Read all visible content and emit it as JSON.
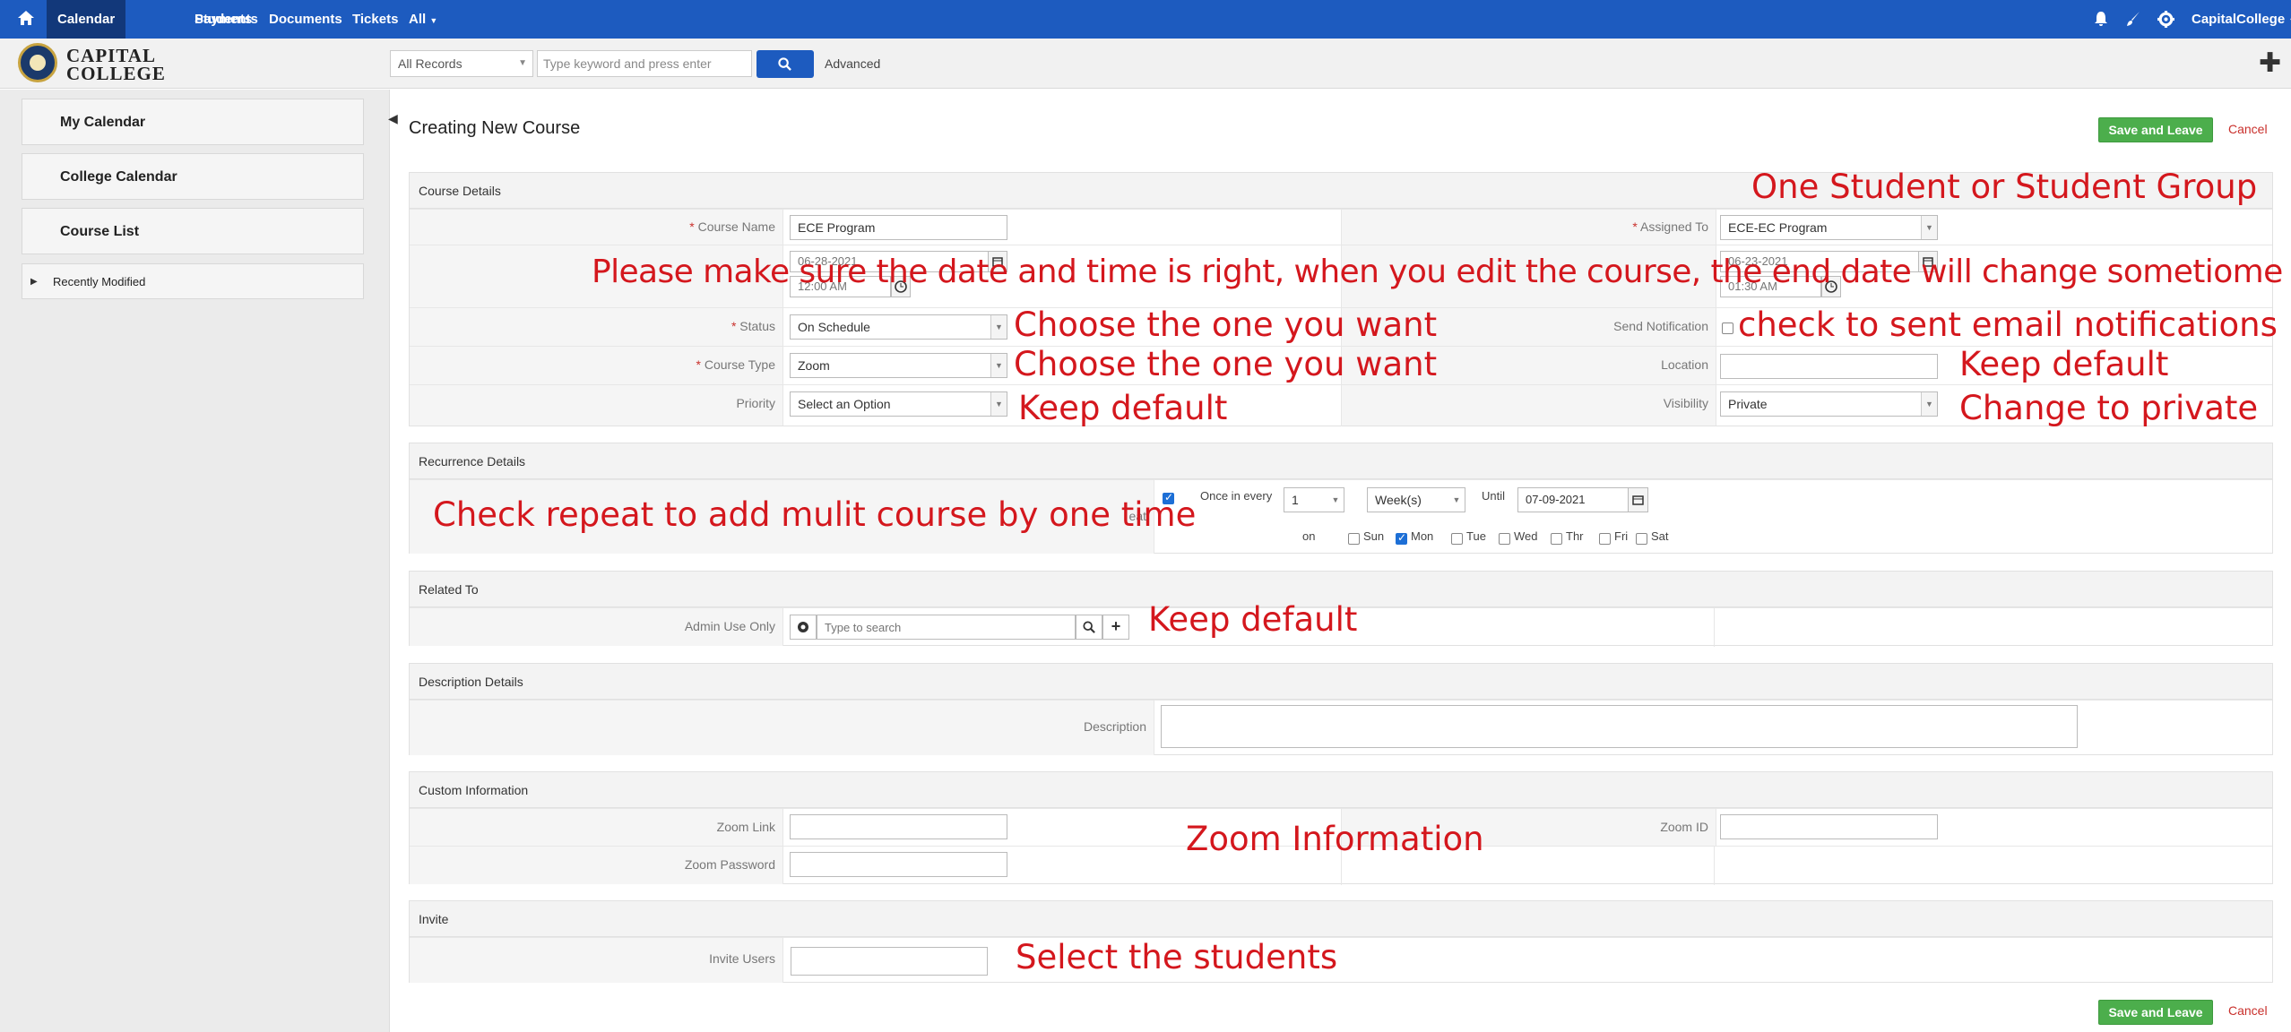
{
  "topnav": {
    "tabs": [
      "Calendar",
      "Students",
      "Payments",
      "Documents",
      "Tickets",
      "All"
    ],
    "user": "CapitalCollege"
  },
  "subbar": {
    "logo_line1": "CAPITAL",
    "logo_line2": "COLLEGE",
    "records_select": "All Records",
    "search_placeholder": "Type keyword and press enter",
    "advanced_label": "Advanced"
  },
  "sidebar": {
    "items": [
      "My Calendar",
      "College Calendar",
      "Course List"
    ],
    "recently_modified": "Recently Modified"
  },
  "page": {
    "title": "Creating New Course",
    "save_label": "Save and Leave",
    "cancel_label": "Cancel"
  },
  "course_details": {
    "heading": "Course Details",
    "course_name_label": "Course Name",
    "course_name_value": "ECE Program",
    "assigned_to_label": "Assigned To",
    "assigned_to_value": "ECE-EC Program",
    "start_date": "06-28-2021",
    "start_time": "12:00 AM",
    "end_date": "06-23-2021",
    "end_time": "01:30 AM",
    "status_label": "Status",
    "status_value": "On Schedule",
    "send_notification_label": "Send Notification",
    "course_type_label": "Course Type",
    "course_type_value": "Zoom",
    "location_label": "Location",
    "priority_label": "Priority",
    "priority_value": "Select an Option",
    "visibility_label": "Visibility",
    "visibility_value": "Private"
  },
  "recurrence": {
    "heading": "Recurrence Details",
    "repeat_label_fragment": "eat",
    "once_in_every_label": "Once in every",
    "interval_value": "1",
    "unit_value": "Week(s)",
    "until_label": "Until",
    "until_value": "07-09-2021",
    "on_label": "on",
    "days": [
      "Sun",
      "Mon",
      "Tue",
      "Wed",
      "Thr",
      "Fri",
      "Sat"
    ],
    "days_checked": [
      false,
      true,
      false,
      false,
      false,
      false,
      false
    ]
  },
  "related": {
    "heading": "Related To",
    "admin_label": "Admin Use Only",
    "search_placeholder": "Type to search"
  },
  "description": {
    "heading": "Description Details",
    "label": "Description"
  },
  "custom": {
    "heading": "Custom Information",
    "zoom_link_label": "Zoom Link",
    "zoom_id_label": "Zoom ID",
    "zoom_password_label": "Zoom Password"
  },
  "invite": {
    "heading": "Invite",
    "label": "Invite Users"
  },
  "annotations": {
    "student_group": "One Student or Student Group",
    "date_warning": "Please make sure the date and time is right, when you edit the course, the end date will change sometiome",
    "choose_status": "Choose the one you want",
    "email_notify": "check to sent email notifications",
    "choose_type": "Choose the one you want",
    "keep_default_location": "Keep default",
    "keep_default_priority": "Keep default",
    "change_private": "Change to private",
    "check_repeat": "Check repeat to add mulit course by one time",
    "keep_default_related": "Keep default",
    "zoom_information": "Zoom Information",
    "select_students": "Select the students",
    "color": "#d4171d"
  }
}
